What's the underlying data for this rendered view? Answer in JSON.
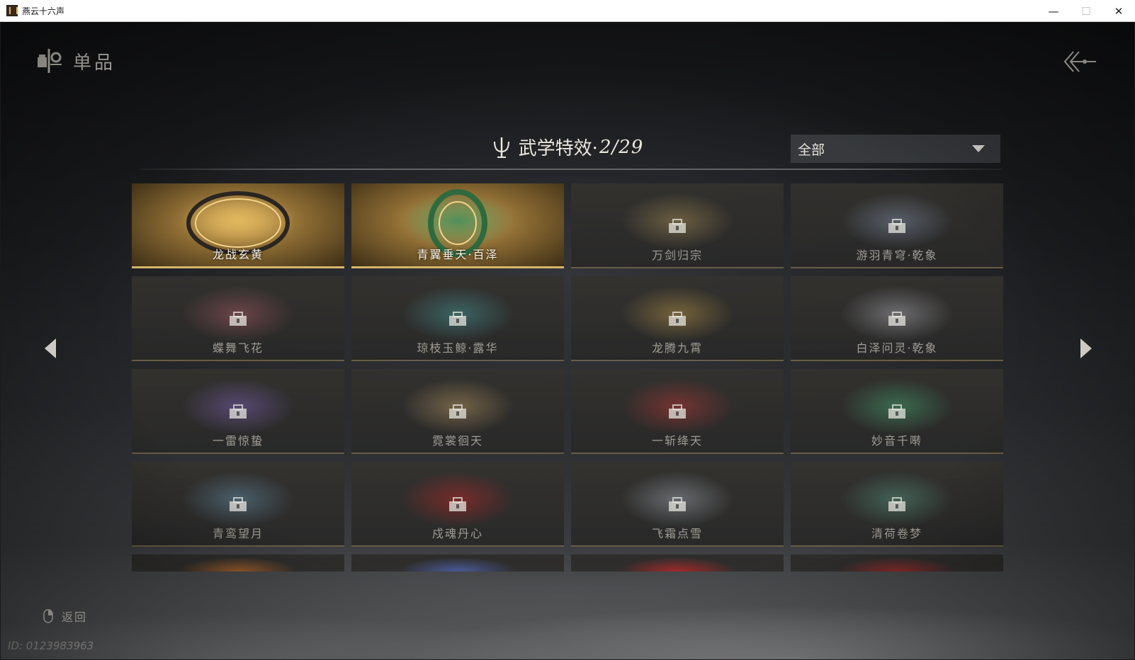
{
  "window": {
    "title": "燕云十六声",
    "minimize": "—",
    "maximize": "☐",
    "close": "✕"
  },
  "header": {
    "title": "单品"
  },
  "section": {
    "title": "武学特效·",
    "count": "2/29"
  },
  "filter": {
    "selected": "全部"
  },
  "items": [
    {
      "name": "龙战玄黄",
      "unlocked": true,
      "accent": "#e2b95e"
    },
    {
      "name": "青翼垂天·百泽",
      "unlocked": true,
      "accent": "#3f8c5a"
    },
    {
      "name": "万剑归宗",
      "unlocked": false,
      "accent": "#b59a5a"
    },
    {
      "name": "游羽青穹·乾象",
      "unlocked": false,
      "accent": "#8a9ab5"
    },
    {
      "name": "蝶舞飞花",
      "unlocked": false,
      "accent": "#b5606a"
    },
    {
      "name": "琼枝玉鲸·露华",
      "unlocked": false,
      "accent": "#4aa6a6"
    },
    {
      "name": "龙腾九霄",
      "unlocked": false,
      "accent": "#c9a24a"
    },
    {
      "name": "白泽问灵·乾象",
      "unlocked": false,
      "accent": "#b8b8c2"
    },
    {
      "name": "一雷惊蛰",
      "unlocked": false,
      "accent": "#8a6ac9"
    },
    {
      "name": "霓裳徊天",
      "unlocked": false,
      "accent": "#c9a56a"
    },
    {
      "name": "一斩绛天",
      "unlocked": false,
      "accent": "#c93a3a"
    },
    {
      "name": "妙音千啭",
      "unlocked": false,
      "accent": "#4ab57a"
    },
    {
      "name": "青鸾望月",
      "unlocked": false,
      "accent": "#6a9ab5"
    },
    {
      "name": "戍魂丹心",
      "unlocked": false,
      "accent": "#d02828"
    },
    {
      "name": "飞霜点雪",
      "unlocked": false,
      "accent": "#aab4c0"
    },
    {
      "name": "清荷卷梦",
      "unlocked": false,
      "accent": "#5aa08a"
    }
  ],
  "partial_items": [
    {
      "accent": "#9a5a2a"
    },
    {
      "accent": "#4a5a9a"
    },
    {
      "accent": "#a02a2a"
    },
    {
      "accent": "#8a2a2a"
    }
  ],
  "footer": {
    "back_label": "返回"
  },
  "player_id": "ID: 0123983963",
  "icons": {
    "header": "collection-icon",
    "back_top": "back-arrow-icon",
    "section": "trident-icon",
    "lock": "lock-icon",
    "nav_left": "arrow-left-icon",
    "nav_right": "arrow-right-icon",
    "mouse": "mouse-icon"
  }
}
